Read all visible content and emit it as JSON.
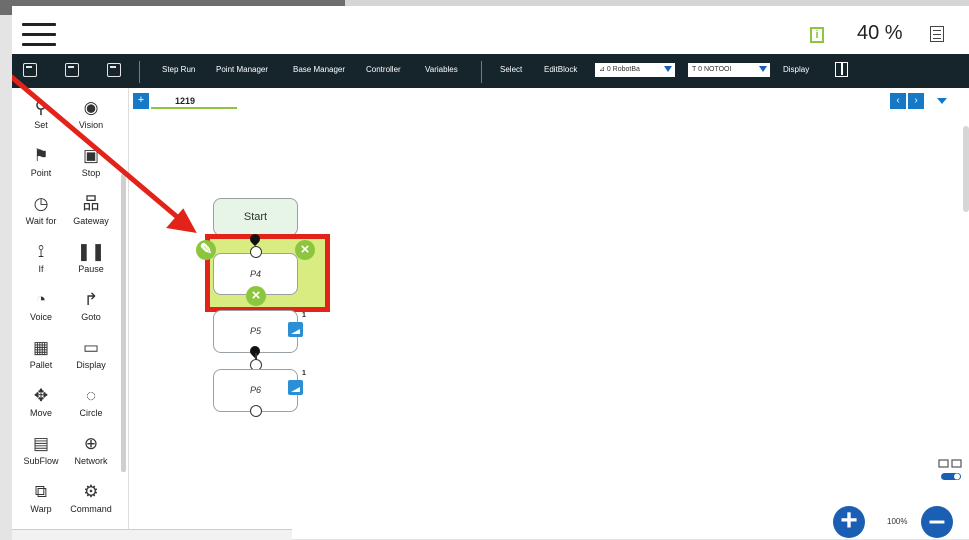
{
  "status": {
    "battery": "40 %"
  },
  "toolbar": {
    "items": [
      "Step Run",
      "Point Manager",
      "Base Manager",
      "Controller",
      "Variables",
      "Select",
      "EditBlock",
      "Display"
    ],
    "robot_base": "0 RobotBa",
    "tool": "0 NOTOOI",
    "tool_prefix": "T"
  },
  "palette": {
    "items": [
      {
        "label": "Set",
        "icon": "set-icon",
        "glyph": "⚲"
      },
      {
        "label": "Vision",
        "icon": "vision-icon",
        "glyph": "◉"
      },
      {
        "label": "Point",
        "icon": "point-icon",
        "glyph": "⚑"
      },
      {
        "label": "Stop",
        "icon": "stop-icon",
        "glyph": "▣"
      },
      {
        "label": "Wait for",
        "icon": "wait-for-icon",
        "glyph": "◷"
      },
      {
        "label": "Gateway",
        "icon": "gateway-icon",
        "glyph": "品"
      },
      {
        "label": "If",
        "icon": "if-icon",
        "glyph": "⟟"
      },
      {
        "label": "Pause",
        "icon": "pause-icon",
        "glyph": "❚❚"
      },
      {
        "label": "Voice",
        "icon": "voice-icon",
        "glyph": "◔"
      },
      {
        "label": "Goto",
        "icon": "goto-icon",
        "glyph": "↱"
      },
      {
        "label": "Pallet",
        "icon": "pallet-icon",
        "glyph": "▦"
      },
      {
        "label": "Display",
        "icon": "display-block-icon",
        "glyph": "▭"
      },
      {
        "label": "Move",
        "icon": "move-icon",
        "glyph": "✥"
      },
      {
        "label": "Circle",
        "icon": "circle-icon",
        "glyph": "◌"
      },
      {
        "label": "SubFlow",
        "icon": "subflow-icon",
        "glyph": "▤"
      },
      {
        "label": "Network",
        "icon": "network-icon",
        "glyph": "⊕"
      },
      {
        "label": "Warp",
        "icon": "warp-icon",
        "glyph": "⧉"
      },
      {
        "label": "Command",
        "icon": "command-icon",
        "glyph": "⚙"
      }
    ]
  },
  "tabs": {
    "add": "+",
    "project": "1219",
    "prev": "‹",
    "next": "›"
  },
  "flow": {
    "start": "Start",
    "nodes": [
      {
        "label": "P4"
      },
      {
        "label": "P5",
        "badge": "1"
      },
      {
        "label": "P6",
        "badge": "1"
      }
    ]
  },
  "zoom": {
    "level": "100%",
    "plus": "+",
    "minus": "–"
  },
  "colors": {
    "highlight_border": "#e2231a",
    "highlight_fill": "#d9ec82",
    "accent_green": "#8cc63f",
    "accent_blue": "#1a5fb4",
    "toolbar_bg": "#16252c"
  }
}
